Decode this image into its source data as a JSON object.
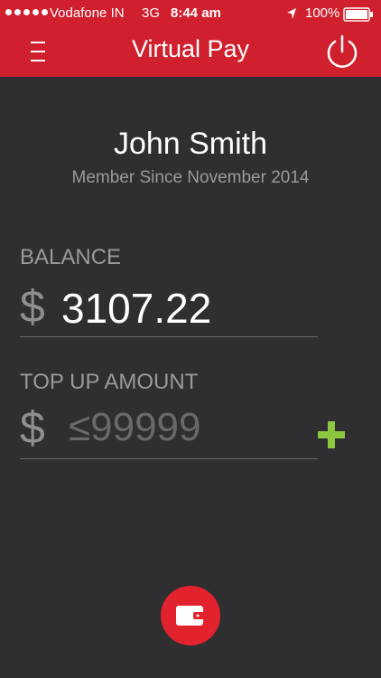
{
  "status_bar": {
    "carrier": "Vodafone IN",
    "network": "3G",
    "time": "8:44 am",
    "battery_percent": "100%",
    "icons": [
      "signal-dots-icon",
      "location-arrow-icon",
      "battery-icon"
    ]
  },
  "header": {
    "title": "Virtual Pay",
    "menu_icon": "hamburger-menu-icon",
    "power_icon": "power-icon",
    "color": "#d0202e"
  },
  "user": {
    "name": "John Smith",
    "member_since": "Member Since November 2014"
  },
  "balance": {
    "label": "BALANCE",
    "currency": "$",
    "amount": "3107.22"
  },
  "top_up": {
    "label": "TOP UP AMOUNT",
    "currency": "$",
    "value": "",
    "placeholder": "≤99999",
    "add_icon": "plus-icon",
    "add_color": "#8dc63f"
  },
  "wallet_button": {
    "icon": "wallet-icon",
    "color": "#e2222d"
  },
  "colors": {
    "background": "#2f2f31",
    "muted_text": "#9a9a9c"
  }
}
